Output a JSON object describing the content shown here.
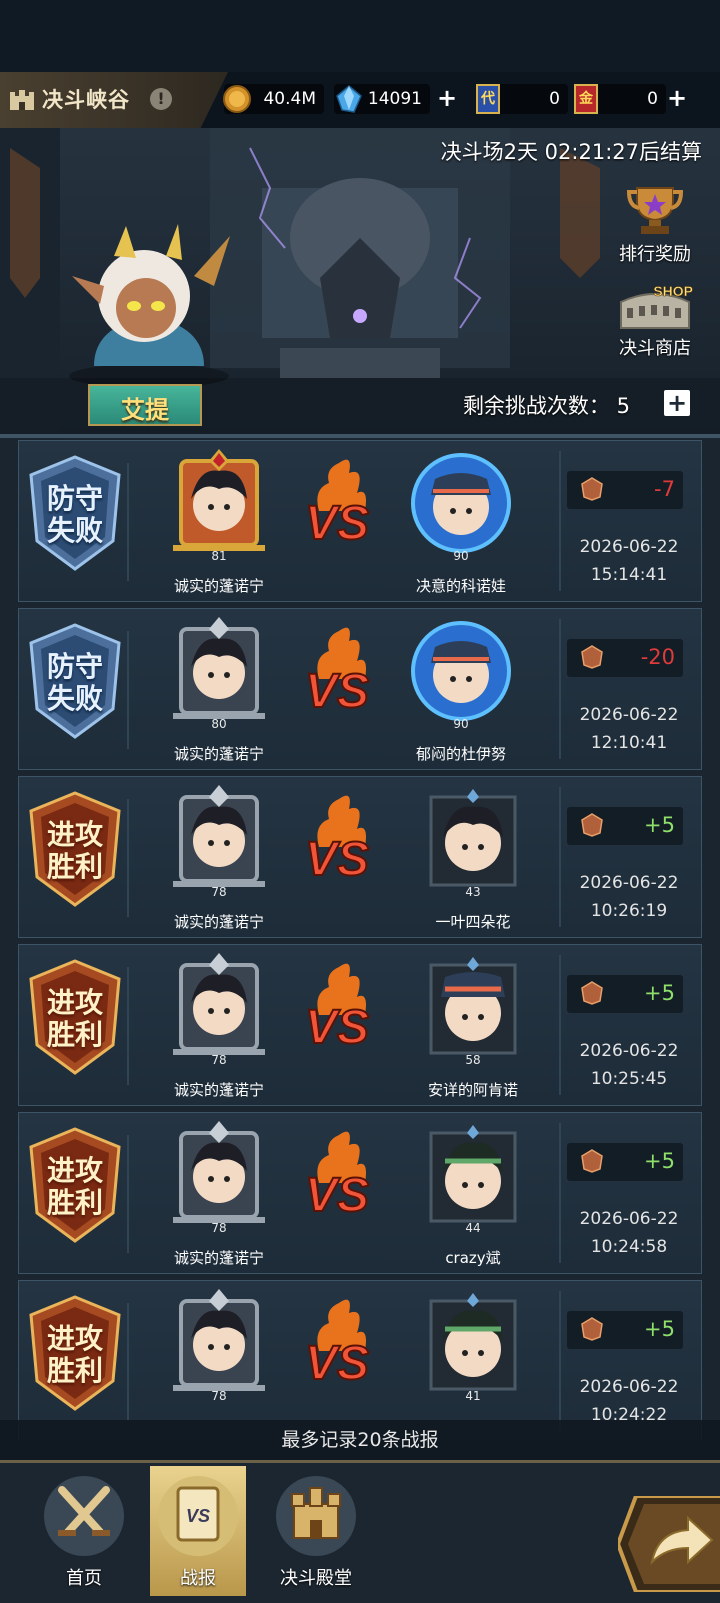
{
  "header": {
    "title": "决斗峡谷",
    "gold": "40.4M",
    "crystals": "14091",
    "ticket_blue_count": "0",
    "ticket_red_count": "0",
    "ticket_blue_char": "代",
    "ticket_red_char": "金"
  },
  "banner": {
    "timer": "决斗场2天 02:21:27后结算",
    "rank_rewards_label": "排行奖励",
    "shop_label": "决斗商店",
    "shop_badge": "SHOP",
    "hero_name": "艾提",
    "remaining_label": "剩余挑战次数：",
    "remaining_count": "5"
  },
  "records": [
    {
      "result": "defense-fail",
      "result_line1": "防守",
      "result_line2": "失败",
      "my_name": "诚实的蓬诺宁",
      "my_level": "81",
      "opp_name": "决意的科诺娃",
      "opp_level": "90",
      "delta": "-7",
      "date": "2026-06-22",
      "time": "15:14:41"
    },
    {
      "result": "defense-fail",
      "result_line1": "防守",
      "result_line2": "失败",
      "my_name": "诚实的蓬诺宁",
      "my_level": "80",
      "opp_name": "郁闷的杜伊努",
      "opp_level": "90",
      "delta": "-20",
      "date": "2026-06-22",
      "time": "12:10:41"
    },
    {
      "result": "attack-win",
      "result_line1": "进攻",
      "result_line2": "胜利",
      "my_name": "诚实的蓬诺宁",
      "my_level": "78",
      "opp_name": "一叶四朵花",
      "opp_level": "43",
      "delta": "+5",
      "date": "2026-06-22",
      "time": "10:26:19"
    },
    {
      "result": "attack-win",
      "result_line1": "进攻",
      "result_line2": "胜利",
      "my_name": "诚实的蓬诺宁",
      "my_level": "78",
      "opp_name": "安详的阿肯诺",
      "opp_level": "58",
      "delta": "+5",
      "date": "2026-06-22",
      "time": "10:25:45"
    },
    {
      "result": "attack-win",
      "result_line1": "进攻",
      "result_line2": "胜利",
      "my_name": "诚实的蓬诺宁",
      "my_level": "78",
      "opp_name": "crazy斌",
      "opp_level": "44",
      "delta": "+5",
      "date": "2026-06-22",
      "time": "10:24:58"
    },
    {
      "result": "attack-win",
      "result_line1": "进攻",
      "result_line2": "胜利",
      "my_name": "",
      "my_level": "78",
      "opp_name": "",
      "opp_level": "41",
      "delta": "+5",
      "date": "2026-06-22",
      "time": "10:24:22"
    }
  ],
  "vs_label": "VS",
  "footer_note": "最多记录20条战报",
  "nav": {
    "home": "首页",
    "reports": "战报",
    "hall": "决斗殿堂",
    "vs_glyph": "VS"
  }
}
